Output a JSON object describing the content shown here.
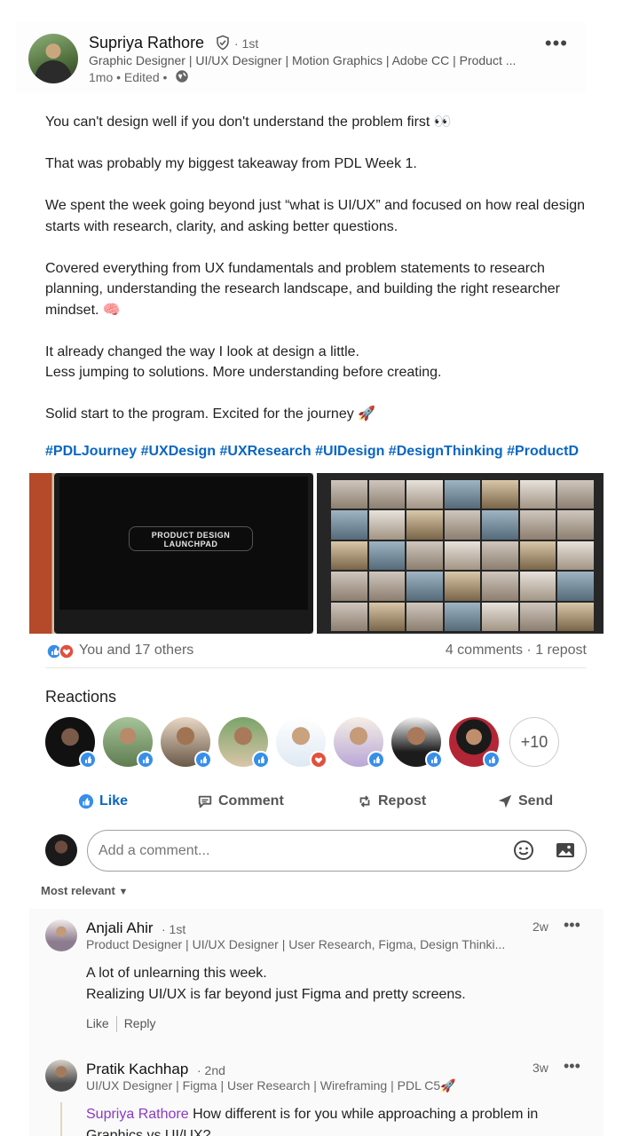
{
  "author": {
    "name": "Supriya Rathore",
    "degree": "· 1st",
    "headline": "Graphic Designer | UI/UX Designer | Motion Graphics | Adobe CC | Product ...",
    "meta": "1mo • Edited •"
  },
  "post": {
    "paragraphs": [
      "You can't design well if you don't understand the problem first 👀",
      "That was probably my biggest takeaway from PDL Week 1.",
      "We spent the week going beyond just “what is UI/UX” and focused on how real design starts with research, clarity, and asking better questions.",
      "Covered everything from UX fundamentals and problem statements to research planning, understanding the research landscape, and building the right researcher mindset. 🧠",
      "It already changed the way I look at design a little.",
      "Less jumping to solutions. More understanding before creating.",
      "Solid start to the program. Excited for the journey 🚀"
    ],
    "hashtags": "#PDLJourney #UXDesign #UXResearch #UIDesign #DesignThinking #ProductD",
    "laptop_logo_line1": "PRODUCT DESIGN",
    "laptop_logo_line2": "LAUNCHPAD"
  },
  "social": {
    "reactions_text": "You and 17 others",
    "comments_text": "4 comments · 1 repost"
  },
  "reactions": {
    "heading": "Reactions",
    "more_count": "+10",
    "reactor_badges": [
      "like",
      "like",
      "like",
      "like",
      "love",
      "like",
      "like",
      "like"
    ]
  },
  "actions": {
    "like": "Like",
    "comment": "Comment",
    "repost": "Repost",
    "send": "Send"
  },
  "comment_box": {
    "placeholder": "Add a comment..."
  },
  "sort_label": "Most relevant",
  "comments": [
    {
      "name": "Anjali Ahir",
      "degree": "· 1st",
      "headline": "Product Designer | UI/UX Designer | User Research, Figma, Design Thinki...",
      "time": "2w",
      "text_line1": "A lot of unlearning this week.",
      "text_line2": "Realizing UI/UX is far beyond just Figma and pretty screens.",
      "like": "Like",
      "reply": "Reply"
    },
    {
      "name": "Pratik Kachhap",
      "degree": "· 2nd",
      "headline": "UI/UX Designer | Figma | User Research | Wireframing | PDL C5🚀",
      "time": "3w",
      "mention": "Supriya Rathore",
      "text_after_mention": " How different is for you while approaching a problem in",
      "text_line2": "Graphics vs UI/UX?"
    }
  ],
  "colors": {
    "accent": "#0a66c2",
    "mention": "#8a3ac2",
    "love": "#e0513f"
  }
}
